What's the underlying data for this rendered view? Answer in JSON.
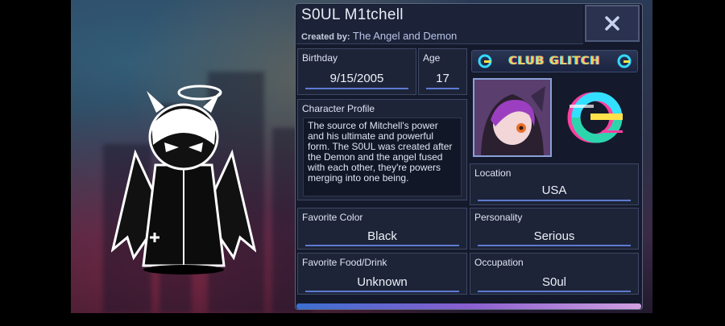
{
  "character": {
    "name": "S0UL M1tchell",
    "created_by_label": "Created by:",
    "created_by": "The Angel and Demon"
  },
  "birthday": {
    "label": "Birthday",
    "value": "9/15/2005"
  },
  "age": {
    "label": "Age",
    "value": "17"
  },
  "profile": {
    "label": "Character Profile",
    "text": "The source of Mitchell's power and his ultimate and powerful form. The S0UL was created after the Demon and the angel fused with each other, they're powers merging into one being."
  },
  "location": {
    "label": "Location",
    "value": "USA"
  },
  "favorite_color": {
    "label": "Favorite Color",
    "value": "Black"
  },
  "personality": {
    "label": "Personality",
    "value": "Serious"
  },
  "favorite_food": {
    "label": "Favorite Food/Drink",
    "value": "Unknown"
  },
  "occupation": {
    "label": "Occupation",
    "value": "S0ul"
  },
  "club_logo": "CLUB GLITCH",
  "icons": {
    "close": "close-icon",
    "glitch": "glitch-logo-icon"
  },
  "colors": {
    "panel": "#141a2c",
    "accent": "#5d7ad0",
    "logo_text": "#e8d25a"
  }
}
